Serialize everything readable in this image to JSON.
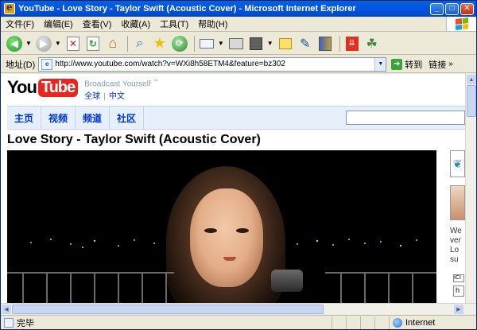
{
  "window": {
    "title": "YouTube - Love Story - Taylor Swift (Acoustic Cover) - Microsoft Internet Explorer",
    "minimize": "_",
    "maximize": "□",
    "close": "✕"
  },
  "menu": {
    "items": [
      "文件(F)",
      "编辑(E)",
      "查看(V)",
      "收藏(A)",
      "工具(T)",
      "帮助(H)"
    ]
  },
  "toolbar": {
    "icons": [
      "back-icon",
      "forward-icon",
      "stop-icon",
      "refresh-icon",
      "home-icon",
      "search-icon",
      "favorites-icon",
      "history-icon",
      "mail-icon",
      "print-icon",
      "edit-icon",
      "discuss-icon",
      "messenger-icon",
      "research-icon",
      "toolbar-addon-icon",
      "msn-icon"
    ]
  },
  "address": {
    "label": "地址(D)",
    "url": "http://www.youtube.com/watch?v=WXi8h58ETM4&feature=bz302",
    "go_label": "转到",
    "links_label": "链接"
  },
  "page": {
    "logo_you": "You",
    "logo_tube": "Tube",
    "slogan": "Broadcast Yourself",
    "slogan_tm": "™",
    "lang_global": "全球",
    "lang_separator": "|",
    "lang_chinese": "中文",
    "nav": [
      "主页",
      "视频",
      "频道",
      "社区"
    ],
    "video_title": "Love Story - Taylor Swift (Acoustic Cover)",
    "side_text": "We\nver\nLo\nsu",
    "side_box_text": "ICI",
    "side_box2_text": "h"
  },
  "status": {
    "text": "完毕",
    "zone": "Internet"
  },
  "colors": {
    "title_bar": "#0058e6",
    "youtube_red": "#e6261f",
    "link_blue": "#0033cc"
  }
}
